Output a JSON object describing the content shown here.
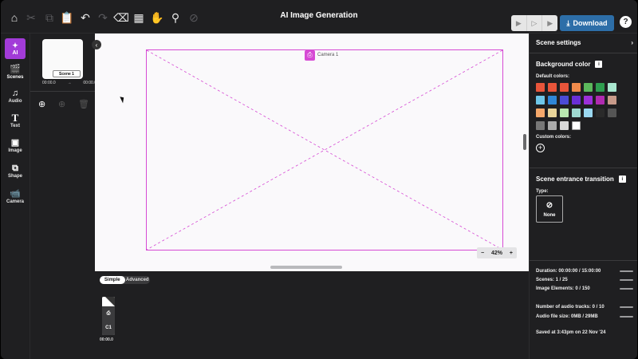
{
  "topbar": {
    "title": "AI Image Generation",
    "download_label": "Download",
    "help_label": "?"
  },
  "rail": {
    "ai_label": "AI",
    "items": [
      {
        "label": "Scenes",
        "icon": "clapperboard-icon"
      },
      {
        "label": "Audio",
        "icon": "music-note-icon"
      },
      {
        "label": "Text",
        "icon": "text-icon"
      },
      {
        "label": "Image",
        "icon": "image-icon"
      },
      {
        "label": "Shape",
        "icon": "shapes-icon"
      },
      {
        "label": "Camera",
        "icon": "camera-icon"
      }
    ]
  },
  "scenes_panel": {
    "scene_label": "Scene 1",
    "start_time": "00:00.0",
    "arrow": "→",
    "end_time": "00:00.0"
  },
  "canvas": {
    "camera_label": "Camera 1",
    "zoom_minus": "−",
    "zoom_value": "42%",
    "zoom_plus": "+",
    "frame_color": "#d64ad4",
    "background": "#faf9fb"
  },
  "timeline": {
    "mode_simple": "Simple",
    "mode_advanced": "Advanced",
    "clip_label": "C1",
    "clip_time": "00:00.0"
  },
  "right_panel": {
    "header": "Scene settings",
    "background_color_title": "Background color",
    "default_colors_label": "Default colors:",
    "custom_colors_label": "Custom colors:",
    "swatches": [
      "#e8553a",
      "#e8553a",
      "#e8553a",
      "#f08a4b",
      "#5cb85c",
      "#2e9e4f",
      "#a8e6cf",
      "#6ec6e8",
      "#2f86d6",
      "#4b4bd6",
      "#6a2fd6",
      "#9b30d9",
      "#b02ab0",
      "#c79a8a",
      "#f5a86b",
      "#e8d49a",
      "#b8e6b0",
      "#9fd8d0",
      "#9ad8f0",
      "#2a2a2a",
      "#555555",
      "#777777",
      "#aaaaaa",
      "#d8d8d8",
      "#ffffff"
    ],
    "transition_title": "Scene entrance transition",
    "type_label": "Type:",
    "type_value": "None",
    "stats": [
      "Duration: 00:00:00 / 15:00:00",
      "Scenes: 1 / 25",
      "Image Elements: 0 / 150",
      "Number of audio tracks: 0 / 10",
      "Audio file size: 0MB / 29MB"
    ],
    "saved_text": "Saved at 3:43pm on 22 Nov '24"
  }
}
